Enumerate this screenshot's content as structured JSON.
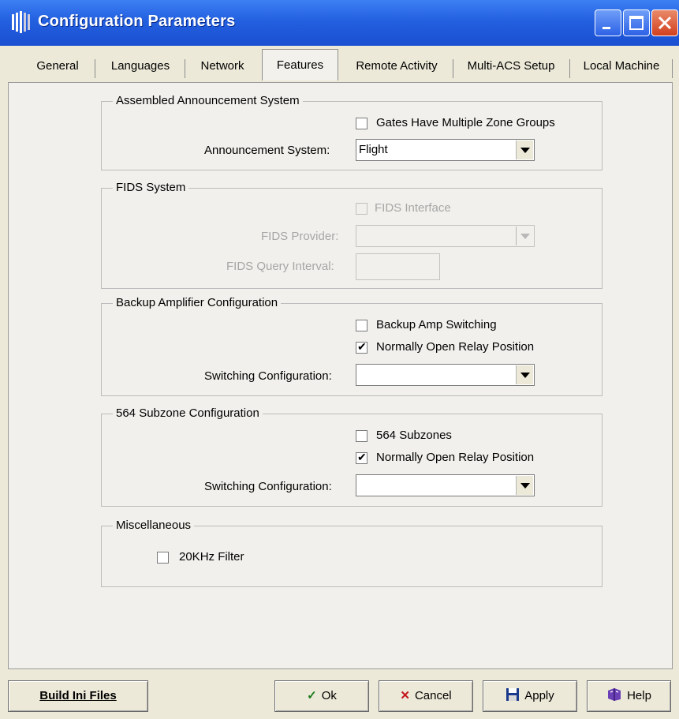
{
  "window": {
    "title": "Configuration Parameters"
  },
  "tabs": [
    {
      "label": "General"
    },
    {
      "label": "Languages"
    },
    {
      "label": "Network"
    },
    {
      "label": "Features",
      "active": true
    },
    {
      "label": "Remote Activity"
    },
    {
      "label": "Multi-ACS Setup"
    },
    {
      "label": "Local Machine"
    }
  ],
  "assembled": {
    "title": "Assembled Announcement System",
    "gates_label": "Gates Have Multiple Zone Groups",
    "gates_checked": false,
    "announcement_label": "Announcement System:",
    "announcement_value": "Flight"
  },
  "fids": {
    "title": "FIDS System",
    "interface_label": "FIDS Interface",
    "interface_checked": false,
    "provider_label": "FIDS Provider:",
    "provider_value": "",
    "query_label": "FIDS Query Interval:",
    "query_value": ""
  },
  "backup": {
    "title": "Backup Amplifier Configuration",
    "switching_label": "Backup Amp Switching",
    "switching_checked": false,
    "relay_label": "Normally Open Relay Position",
    "relay_checked": true,
    "config_label": "Switching Configuration:",
    "config_value": ""
  },
  "subzone": {
    "title": "564 Subzone Configuration",
    "subzones_label": "564 Subzones",
    "subzones_checked": false,
    "relay_label": "Normally Open Relay Position",
    "relay_checked": true,
    "config_label": "Switching Configuration:",
    "config_value": ""
  },
  "misc": {
    "title": "Miscellaneous",
    "filter_label": "20KHz Filter",
    "filter_checked": false
  },
  "buttons": {
    "build": "Build Ini Files",
    "ok": "Ok",
    "cancel": "Cancel",
    "apply": "Apply",
    "help": "Help"
  },
  "check_glyph": "✔",
  "icons": {
    "ok": "checkmark-icon",
    "cancel": "x-icon",
    "apply": "floppy-disk-icon",
    "help": "help-book-icon"
  }
}
